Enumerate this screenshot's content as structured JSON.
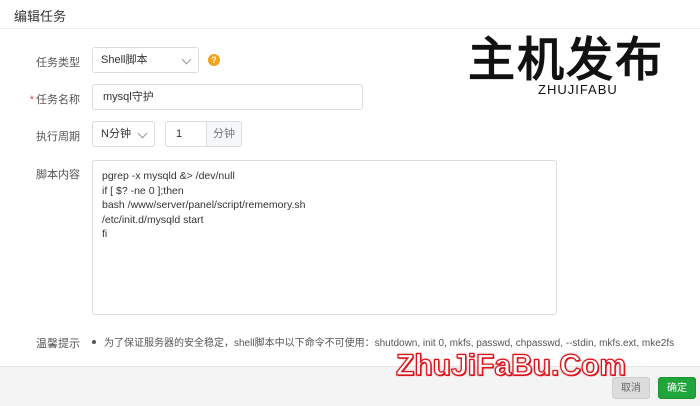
{
  "dialog": {
    "title": "编辑任务"
  },
  "form": {
    "task_type": {
      "label": "任务类型",
      "value": "Shell脚本"
    },
    "task_name": {
      "label": "任务名称",
      "value": "mysql守护",
      "required_mark": "*"
    },
    "period": {
      "label": "执行周期",
      "mode": "N分钟",
      "interval": "1",
      "unit": "分钟"
    },
    "script": {
      "label": "脚本内容",
      "lines": [
        "pgrep -x mysqld &> /dev/null",
        "if [ $? -ne 0 ];then",
        "bash /www/server/panel/script/rememory.sh",
        "/etc/init.d/mysqld start",
        "fi"
      ]
    },
    "tip": {
      "label": "温馨提示",
      "text": "为了保证服务器的安全稳定，shell脚本中以下命令不可使用：shutdown, init 0, mkfs, passwd, chpasswd, --stdin, mkfs.ext, mke2fs"
    }
  },
  "footer": {
    "cancel_label": "取消",
    "ok_label": "确定"
  },
  "watermark": {
    "top_cn": "主机发布",
    "top_en": "ZHUJIFABU",
    "bottom": "ZhuJiFaBu.Com"
  },
  "colors": {
    "accent_green": "#20a53a",
    "help_orange": "#f0a21b",
    "required_red": "#e64d4d",
    "watermark_red": "#d9141b"
  },
  "icons": {
    "help": "question-circle-icon",
    "select_arrow": "chevron-down-icon"
  }
}
